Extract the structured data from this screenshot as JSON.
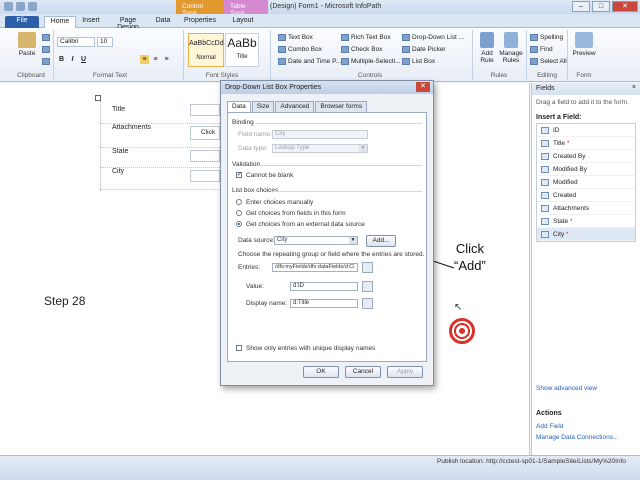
{
  "window": {
    "title": "(Design) Form1 - Microsoft InfoPath",
    "context_tabs": [
      "Control Tools",
      "Table Tools"
    ]
  },
  "ribbon": {
    "tabs": [
      "File",
      "Home",
      "Insert",
      "Page Design",
      "Data",
      "Properties",
      "Layout"
    ],
    "clipboard": {
      "paste": "Paste",
      "label": "Clipboard"
    },
    "font": {
      "name": "Calibri",
      "size": "10",
      "label": "Format Text"
    },
    "styles": {
      "normal_sample": "AaBbCcDd",
      "normal": "Normal",
      "title_sample": "AaBb",
      "title": "Title",
      "label": "Font Styles"
    },
    "controls": {
      "items": [
        "Text Box",
        "Rich Text Box",
        "Drop-Down List ...",
        "Combo Box",
        "Check Box",
        "Date Picker",
        "Date and Time P...",
        "Multiple-Selecti...",
        "List Box"
      ],
      "label": "Controls"
    },
    "rules": {
      "add_rule": "Add Rule",
      "manage_rules": "Manage Rules",
      "label": "Rules"
    },
    "editing": {
      "spelling": "Spelling",
      "find": "Find",
      "select_all": "Select All",
      "label": "Editing"
    },
    "form": {
      "preview": "Preview",
      "label": "Form"
    }
  },
  "form": {
    "rows": [
      "Title",
      "Attachments",
      "State",
      "City"
    ],
    "attach_hint": "Click"
  },
  "annotation": {
    "step": "Step 28",
    "line1": "Click",
    "line2": "“Add”"
  },
  "dialog": {
    "title": "Drop-Down List Box Properties",
    "tabs": [
      "Data",
      "Size",
      "Advanced",
      "Browser forms"
    ],
    "binding_label": "Binding",
    "field_name_label": "Field name:",
    "field_name_value": "City",
    "data_type_label": "Data type:",
    "data_type_value": "Lookup Type",
    "validation_label": "Validation",
    "cannot_be_blank": "Cannot be blank",
    "list_choices_label": "List box choices",
    "choice_manual": "Enter choices manually",
    "choice_fields": "Get choices from fields in this form",
    "choice_external": "Get choices from an external data source",
    "data_source_label": "Data source:",
    "data_source_value": "City",
    "add_button": "Add...",
    "repeating_hint": "Choose the repeating group or field where the entries are stored.",
    "entries_label": "Entries:",
    "entries_value": "/dfs:myFields/dfs:dataFields/d:Ci",
    "value_label": "Value:",
    "value_value": "d:ID",
    "display_label": "Display name:",
    "display_value": "d:Title",
    "unique_only": "Show only entries with unique display names",
    "ok": "OK",
    "cancel": "Cancel",
    "apply": "Apply"
  },
  "fields_panel": {
    "title": "Fields",
    "close": "×",
    "description": "Drag a field to add it to the form.",
    "insert_label": "Insert a Field:",
    "items": [
      {
        "name": "ID",
        "required": ""
      },
      {
        "name": "Title",
        "required": "*"
      },
      {
        "name": "Created By",
        "required": ""
      },
      {
        "name": "Modified By",
        "required": ""
      },
      {
        "name": "Modified",
        "required": ""
      },
      {
        "name": "Created",
        "required": ""
      },
      {
        "name": "Attachments",
        "required": ""
      },
      {
        "name": "State",
        "required": "*"
      },
      {
        "name": "City",
        "required": "*"
      }
    ],
    "show_advanced": "Show advanced view",
    "actions_label": "Actions",
    "add_field": "Add Field",
    "manage_connections": "Manage Data Connections..."
  },
  "status": {
    "publish": "Publish location: http://cctest-sp01-1/SampleSite/Lists/My%20Info"
  }
}
